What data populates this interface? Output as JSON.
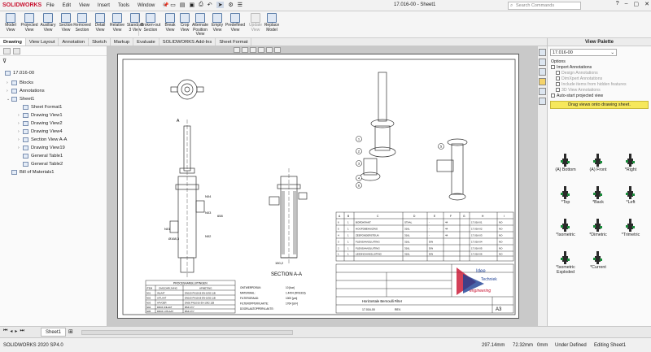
{
  "titlebar": {
    "app_logo": "SOLIDWORKS",
    "menus": [
      "File",
      "Edit",
      "View",
      "Insert",
      "Tools",
      "Window"
    ],
    "document_title": "17.016-00 - Sheet1",
    "search_placeholder": "Search Commands"
  },
  "ribbon": {
    "buttons": [
      {
        "label": "Model View"
      },
      {
        "label": "Projected View"
      },
      {
        "label": "Auxiliary View"
      },
      {
        "label": "Section View"
      },
      {
        "label": "Removed Section"
      },
      {
        "label": "Detail View"
      },
      {
        "label": "Relative View"
      },
      {
        "label": "Standard 3 View"
      },
      {
        "label": "Broken-out Section"
      },
      {
        "label": "Break View"
      },
      {
        "label": "Crop View"
      },
      {
        "label": "Alternate Position View"
      },
      {
        "label": "Empty View"
      },
      {
        "label": "Predefined View"
      },
      {
        "label": "Update View"
      },
      {
        "label": "Replace Model"
      }
    ]
  },
  "tabs": [
    "Drawing",
    "View Layout",
    "Annotation",
    "Sketch",
    "Markup",
    "Evaluate",
    "SOLIDWORKS Add-Ins",
    "Sheet Format"
  ],
  "tree": {
    "root": "17.016-00",
    "items": [
      {
        "label": "Blocks",
        "level": 1
      },
      {
        "label": "Annotations",
        "level": 1
      },
      {
        "label": "Sheet1",
        "level": 1
      },
      {
        "label": "Sheet Format1",
        "level": 2
      },
      {
        "label": "Drawing View1",
        "level": 2
      },
      {
        "label": "Drawing View2",
        "level": 2
      },
      {
        "label": "Drawing View4",
        "level": 2
      },
      {
        "label": "Section View A-A",
        "level": 2
      },
      {
        "label": "Drawing View19",
        "level": 2
      },
      {
        "label": "General Table1",
        "level": 2
      },
      {
        "label": "General Table2",
        "level": 2
      },
      {
        "label": "Bill of Materials1",
        "level": 1
      }
    ]
  },
  "drawing": {
    "section_label": "SECTION A-A",
    "section_letter": "A",
    "dims": [
      "N04",
      "N03",
      "N01",
      "N02",
      "658",
      "150,2",
      "Ø168,3"
    ],
    "balloons": [
      "1",
      "2",
      "3",
      "4",
      "5",
      "6"
    ],
    "bom_columns": [
      "A",
      "B",
      "C",
      "D",
      "E",
      "F",
      "G",
      "H",
      "I"
    ],
    "bom_rows": [
      [
        "6",
        "1",
        "BORDKRANT",
        "STAAL",
        "-",
        "44",
        "",
        "17.016-01",
        "NO"
      ],
      [
        "5",
        "1",
        "HOOFDBEHUIZING",
        "316L",
        "-",
        "44",
        "",
        "17.016-02",
        "NO"
      ],
      [
        "4",
        "1",
        "ZEEFONDERSTEUN",
        "316L",
        "-",
        "44",
        "",
        "17.016-03",
        "NO"
      ],
      [
        "3",
        "1",
        "FLENSAANSLUITING",
        "316L",
        "DIN",
        "",
        "",
        "17.016-04",
        "NO"
      ],
      [
        "2",
        "1",
        "FLENSAANSLUITING",
        "316L",
        "DIN",
        "",
        "",
        "17.016-05",
        "NO"
      ],
      [
        "1",
        "1",
        "LEIDINGAANSLUITING",
        "316L",
        "DIN",
        "",
        "",
        "17.016-06",
        "NO"
      ]
    ],
    "process_table": {
      "title": "PROCESAANSLUITINGEN",
      "headers": [
        "ITEM",
        "OMSCHRIJVING",
        "AFMETING"
      ],
      "rows": [
        [
          "N01",
          "INLAAT",
          "DN100 PN10/16 EN-1092 11B"
        ],
        [
          "N02",
          "UITLAAT",
          "DN100 PN10/16 EN-1092 11B"
        ],
        [
          "N03",
          "AFVOER",
          "DN50 PN10/16 EN-1092 11B"
        ],
        [
          "N04",
          "DRUK INLAAT",
          "BSK G½\""
        ],
        [
          "N05",
          "DRUK UITLAAT",
          "BSK G½\""
        ]
      ]
    },
    "specs": [
      [
        "ONTWERPDRUK:",
        "10 [bar]"
      ],
      [
        "MATERIAAL:",
        "1.4404 (RVS316)"
      ],
      [
        "FILTERGRAAD:",
        "1000 [µm]"
      ],
      [
        "FILTEROPPERVLAKTE:",
        "1764 [cm²]"
      ],
      [
        "DOORLAATOPPERVLAKTE:",
        ""
      ]
    ],
    "titleblock": {
      "title": "Horizontale Bernoulli Filter",
      "drawing_no": "17.016-00",
      "size": "A3",
      "company_line1": "Idee",
      "company_line2": "Techniek",
      "company_line3": "engineering",
      "rev_label": "REV."
    }
  },
  "palette": {
    "title": "View Palette",
    "selected": "17.016-00",
    "options_label": "Options",
    "import_annotations": "Import Annotations",
    "sub_options": [
      "Design Annotations",
      "DimXpert Annotations",
      "Include items from hidden features",
      "3D View Annotations"
    ],
    "auto_start": "Auto-start projected view",
    "drag_hint": "Drag views onto drawing sheet.",
    "views": [
      "(A) Bottom",
      "(A) Front",
      "*Right",
      "*Top",
      "*Back",
      "*Left",
      "*Isometric",
      "*Dimetric",
      "*Trimetric",
      "*Isometric Exploded",
      "*Current"
    ]
  },
  "bottom": {
    "sheet_tab": "Sheet1"
  },
  "status": {
    "version": "SOLIDWORKS 2020 SP4.0",
    "x": "297.14mm",
    "y": "72.32mm",
    "z": "0mm",
    "state": "Under Defined",
    "editing": "Editing Sheet1"
  }
}
